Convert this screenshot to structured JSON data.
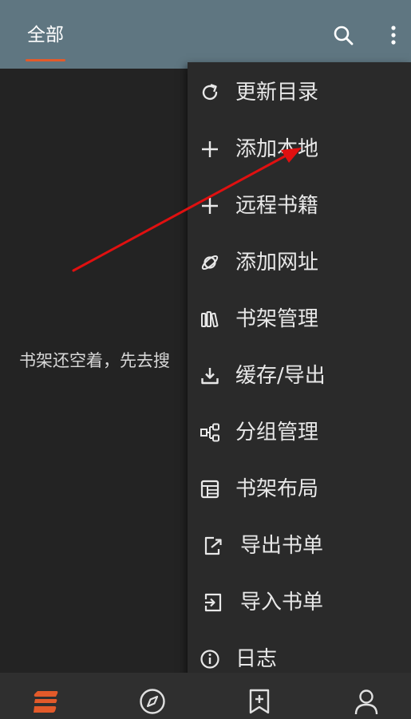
{
  "header": {
    "tab_all_label": "全部",
    "search_icon": "search-icon",
    "more_icon": "more-vertical-icon"
  },
  "main": {
    "empty_text": "书架还空着，先去搜"
  },
  "menu": {
    "items": [
      {
        "label": "更新目录",
        "icon": "refresh-icon"
      },
      {
        "label": "添加本地",
        "icon": "plus-icon"
      },
      {
        "label": "远程书籍",
        "icon": "plus-icon"
      },
      {
        "label": "添加网址",
        "icon": "planet-icon"
      },
      {
        "label": "书架管理",
        "icon": "bookshelf-icon"
      },
      {
        "label": "缓存/导出",
        "icon": "download-icon"
      },
      {
        "label": "分组管理",
        "icon": "group-icon"
      },
      {
        "label": "书架布局",
        "icon": "layout-icon"
      },
      {
        "label": "导出书单",
        "icon": "export-icon"
      },
      {
        "label": "导入书单",
        "icon": "import-icon"
      },
      {
        "label": "日志",
        "icon": "info-icon"
      }
    ]
  },
  "bottom_nav": {
    "items": [
      {
        "name": "bookshelf",
        "icon": "bookshelf-logo-icon"
      },
      {
        "name": "discover",
        "icon": "compass-icon"
      },
      {
        "name": "rss",
        "icon": "bookmark-plus-icon"
      },
      {
        "name": "my",
        "icon": "person-icon"
      }
    ]
  },
  "colors": {
    "topbar": "#5f7681",
    "background": "#232323",
    "menu_bg": "#2a2a2a",
    "accent": "#e35a2a",
    "annotation_arrow": "#e01010"
  }
}
